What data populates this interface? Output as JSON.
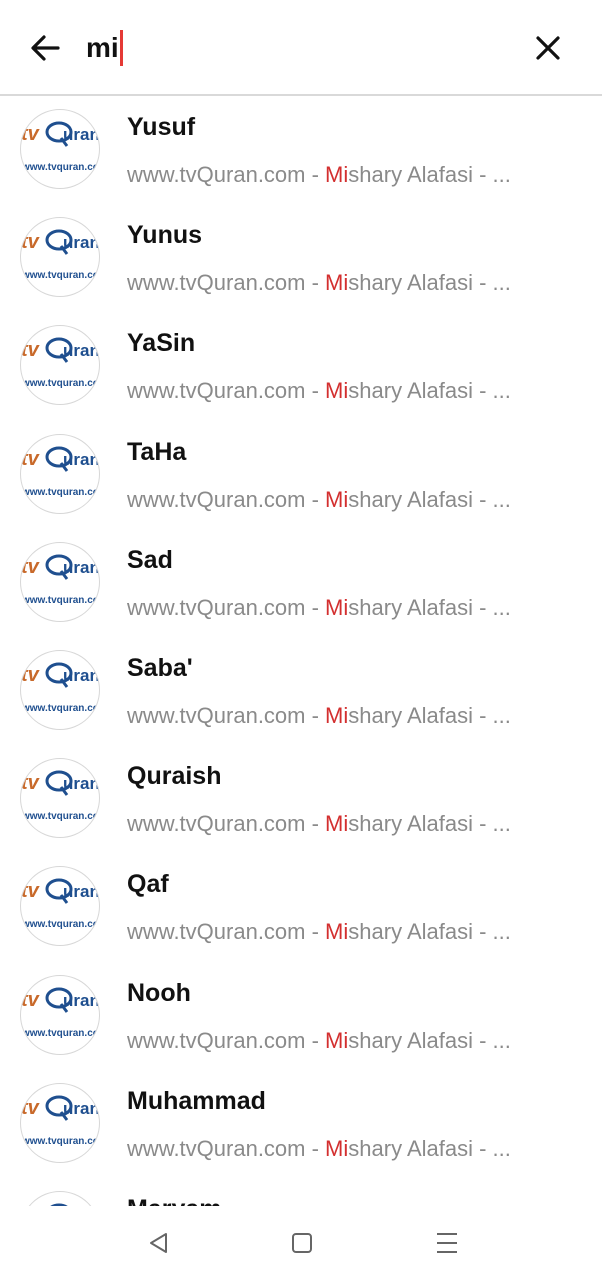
{
  "search": {
    "query": "mi"
  },
  "results": [
    {
      "title": "Yusuf",
      "source": "www.tvQuran.com - ",
      "match": "Mi",
      "rest": "shary Alafasi - ..."
    },
    {
      "title": "Yunus",
      "source": "www.tvQuran.com - ",
      "match": "Mi",
      "rest": "shary Alafasi - ..."
    },
    {
      "title": "YaSin",
      "source": "www.tvQuran.com - ",
      "match": "Mi",
      "rest": "shary Alafasi - ..."
    },
    {
      "title": "TaHa",
      "source": "www.tvQuran.com - ",
      "match": "Mi",
      "rest": "shary Alafasi - ..."
    },
    {
      "title": "Sad",
      "source": "www.tvQuran.com - ",
      "match": "Mi",
      "rest": "shary Alafasi - ..."
    },
    {
      "title": "Saba'",
      "source": "www.tvQuran.com - ",
      "match": "Mi",
      "rest": "shary Alafasi - ..."
    },
    {
      "title": "Quraish",
      "source": "www.tvQuran.com - ",
      "match": "Mi",
      "rest": "shary Alafasi - ..."
    },
    {
      "title": "Qaf",
      "source": "www.tvQuran.com - ",
      "match": "Mi",
      "rest": "shary Alafasi - ..."
    },
    {
      "title": "Nooh",
      "source": "www.tvQuran.com - ",
      "match": "Mi",
      "rest": "shary Alafasi - ..."
    },
    {
      "title": "Muhammad",
      "source": "www.tvQuran.com - ",
      "match": "Mi",
      "rest": "shary Alafasi - ..."
    },
    {
      "title": "Maryam",
      "source": "",
      "match": "",
      "rest": ""
    }
  ],
  "logo": {
    "brand_tv": "tv",
    "brand_quran": "uran",
    "domain": "www.tvquran.com"
  },
  "colors": {
    "highlight": "#d32f2f",
    "logo_orange": "#c8692a",
    "logo_blue": "#1f4f8f"
  },
  "icons": {
    "back": "arrow-left-icon",
    "clear": "close-icon",
    "nav_back": "triangle-back-icon",
    "nav_home": "square-home-icon",
    "nav_menu": "menu-lines-icon"
  }
}
